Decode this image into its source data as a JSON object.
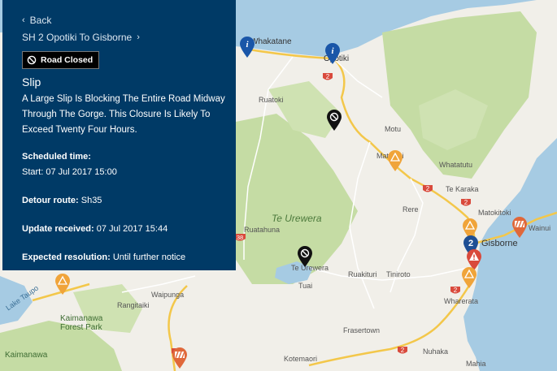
{
  "panel": {
    "back_label": "Back",
    "route_label": "SH 2 Opotiki To Gisborne",
    "status_badge": "Road Closed",
    "event_title": "Slip",
    "description": "A Large Slip Is Blocking The Entire Road Midway Through The Gorge. This Closure Is Likely To Exceed Twenty Four Hours.",
    "scheduled_label": "Scheduled time:",
    "start_label": "Start:",
    "start_value": "07 Jul 2017 15:00",
    "detour_label": "Detour route:",
    "detour_value": "Sh35",
    "update_label": "Update received:",
    "update_value": "07 Jul 2017 15:44",
    "resolution_label": "Expected resolution:",
    "resolution_value": "Until further notice"
  },
  "map": {
    "colors": {
      "sea": "#a6cbe3",
      "land": "#f1efe9",
      "park": "#c5dca4",
      "road": "#f3c74a",
      "panel": "#003a66",
      "marker_info": "#1a56a8",
      "marker_warning": "#f0a43a",
      "marker_closed": "#111111",
      "marker_hazard": "#d94a3c"
    },
    "places": {
      "whakatane": "Whakatane",
      "opotiki": "Opotiki",
      "ruatoki": "Ruatoki",
      "motu": "Motu",
      "matawai": "Matawai",
      "whatatutu": "Whatatutu",
      "te_karaka": "Te Karaka",
      "rere": "Rere",
      "te_urewera_park": "Te Urewera",
      "ruatahuna": "Ruatahuna",
      "te_urewera": "Te Urewera",
      "tuai": "Tuai",
      "ruakituri": "Ruakituri",
      "tiniroto": "Tiniroto",
      "matokitoki": "Matokitoki",
      "gisborne": "Gisborne",
      "wainui": "Wainui",
      "wharerata": "Wharerata",
      "waipunga": "Waipunga",
      "rangitaiki": "Rangitaiki",
      "kaimanawa_forest_park": "Kaimanawa Forest Park",
      "kaimanawa": "Kaimanawa",
      "frasertown": "Frasertown",
      "kotemaori": "Kotemaori",
      "nuhaka": "Nuhaka",
      "mahia": "Mahia",
      "lake_taupo": "Lake Taupo"
    },
    "route_shields": [
      "2",
      "2",
      "2",
      "2",
      "2",
      "5",
      "38"
    ],
    "gisborne_cluster_count": "2",
    "markers": [
      {
        "type": "info",
        "icon": "info-icon"
      },
      {
        "type": "info",
        "icon": "info-icon"
      },
      {
        "type": "closed",
        "icon": "road-closed-icon"
      },
      {
        "type": "warning",
        "icon": "warning-icon"
      },
      {
        "type": "closed",
        "icon": "road-closed-icon"
      },
      {
        "type": "warning",
        "icon": "warning-icon"
      },
      {
        "type": "roadworks",
        "icon": "roadworks-icon"
      },
      {
        "type": "cluster",
        "icon": "cluster-icon"
      },
      {
        "type": "hazard",
        "icon": "hazard-icon"
      },
      {
        "type": "warning",
        "icon": "warning-icon"
      },
      {
        "type": "warning",
        "icon": "warning-icon"
      },
      {
        "type": "roadworks",
        "icon": "roadworks-icon"
      }
    ]
  }
}
